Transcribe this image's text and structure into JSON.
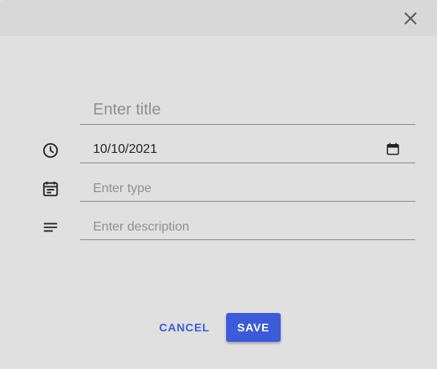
{
  "dialog": {
    "close_icon": "close-icon",
    "title_field": {
      "placeholder": "Enter title",
      "value": ""
    },
    "date_field": {
      "value": "10/10/2021",
      "icon": "clock-icon",
      "picker_icon": "calendar-icon"
    },
    "type_field": {
      "placeholder": "Enter type",
      "value": "",
      "icon": "event-note-icon"
    },
    "description_field": {
      "placeholder": "Enter description",
      "value": "",
      "icon": "notes-icon"
    },
    "buttons": {
      "cancel": "CANCEL",
      "save": "SAVE"
    },
    "colors": {
      "accent": "#3b5bdb",
      "background": "#e0e0e0",
      "header": "#d8d8d8"
    }
  }
}
